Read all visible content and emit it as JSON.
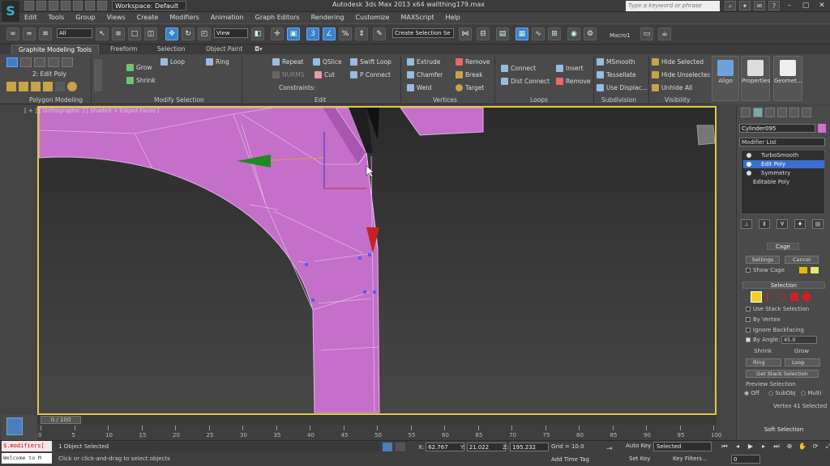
{
  "app": {
    "window_title": "Autodesk 3ds Max  2013 x64      wallthing179.max",
    "workspace": "Workspace: Default",
    "search_placeholder": "Type a keyword or phrase"
  },
  "menu": [
    "Edit",
    "Tools",
    "Group",
    "Views",
    "Create",
    "Modifiers",
    "Animation",
    "Graph Editors",
    "Rendering",
    "Customize",
    "MAXScript",
    "Help"
  ],
  "main_toolbar": {
    "selection_filter": "All",
    "ref_coord": "View",
    "named_selection": "Create Selection Se",
    "macro_label": "Macro1"
  },
  "ribbon": {
    "tabs": [
      "Graphite Modeling Tools",
      "Freeform",
      "Selection",
      "Object Paint"
    ],
    "mode_label": "2: Edit Poly",
    "panels": {
      "polygon_modeling": "Polygon Modeling",
      "modify_selection": "Modify Selection",
      "edit": "Edit",
      "vertices": "Vertices",
      "loops": "Loops",
      "subdivision": "Subdivision",
      "visibility": "Visibility"
    },
    "modify_selection": {
      "grow": "Grow",
      "shrink": "Shrink",
      "loop": "Loop",
      "ring": "Ring"
    },
    "edit": {
      "repeat": "Repeat",
      "qslice": "QSlice",
      "swift_loop": "Swift Loop",
      "nurms": "NURMS",
      "cut": "Cut",
      "p_connect": "P Connect",
      "constraints": "Constraints:"
    },
    "vertices": {
      "extrude": "Extrude",
      "remove": "Remove",
      "chamfer": "Chamfer",
      "break": "Break",
      "weld": "Weld",
      "target": "Target"
    },
    "loops": {
      "connect": "Connect",
      "insert": "Insert",
      "dist_connect": "Dist Connect",
      "remove": "Remove"
    },
    "subdivision": {
      "msmooth": "MSmooth",
      "tessellate": "Tessellate",
      "use_displac": "Use Displac..."
    },
    "visibility": {
      "hide_selected": "Hide Selected",
      "hide_unselected": "Hide Unselected",
      "unhide_all": "Unhide All"
    },
    "big_buttons": [
      "Align",
      "Properties",
      "Geomet..."
    ]
  },
  "viewport": {
    "label": "[ + ] [ Orthographic ] [ Shaded + Edged Faces ]",
    "colors": {
      "frame": "#e2c84b",
      "mesh": "#c46fc9",
      "mesh_dark": "#a857b1",
      "background": "#3a3a3a"
    }
  },
  "command_panel": {
    "object_name": "Cylinder095",
    "modifier_list": "Modifier List",
    "stack": [
      {
        "label": "TurboSmooth",
        "selected": false
      },
      {
        "label": "Edit Poly",
        "selected": true
      },
      {
        "label": "Symmetry",
        "selected": false
      },
      {
        "label": "Editable Poly",
        "selected": false
      }
    ],
    "cage": {
      "header": "Cage",
      "settings": "Settings",
      "cancel": "Cancel",
      "show_cage": "Show Cage"
    },
    "selection": {
      "header": "Selection",
      "use_stack_selection": "Use Stack Selection",
      "by_vertex": "By Vertex",
      "ignore_backfacing": "Ignore Backfacing",
      "by_angle": "By Angle:",
      "by_angle_value": "45.0",
      "shrink": "Shrink",
      "grow": "Grow",
      "ring": "Ring",
      "loop": "Loop",
      "get_stack_selection": "Get Stack Selection",
      "preview_selection": "Preview Selection",
      "off": "Off",
      "subobj": "SubObj",
      "multi": "Multi",
      "status": "Vertex 41 Selected"
    },
    "soft_selection": "Soft Selection"
  },
  "timeline": {
    "frame_display": "0 / 100",
    "ticks": [
      "0",
      "5",
      "10",
      "15",
      "20",
      "25",
      "30",
      "35",
      "40",
      "45",
      "50",
      "55",
      "60",
      "65",
      "70",
      "75",
      "80",
      "85",
      "90",
      "95",
      "100"
    ]
  },
  "status": {
    "listener_top": "$.modifiers[",
    "listener_bottom": "Welcome to M",
    "line1": "1 Object Selected",
    "line2": "Click or click-and-drag to select objects",
    "x_label": "X:",
    "x": "62.767",
    "y_label": "Y:",
    "y": "21.022",
    "z_label": "Z:",
    "z": "195.232",
    "grid": "Grid = 10.0",
    "add_time_tag": "Add Time Tag",
    "auto_key": "Auto Key",
    "selected": "Selected",
    "set_key": "Set Key",
    "key_filters": "Key Filters...",
    "frame": "0"
  }
}
